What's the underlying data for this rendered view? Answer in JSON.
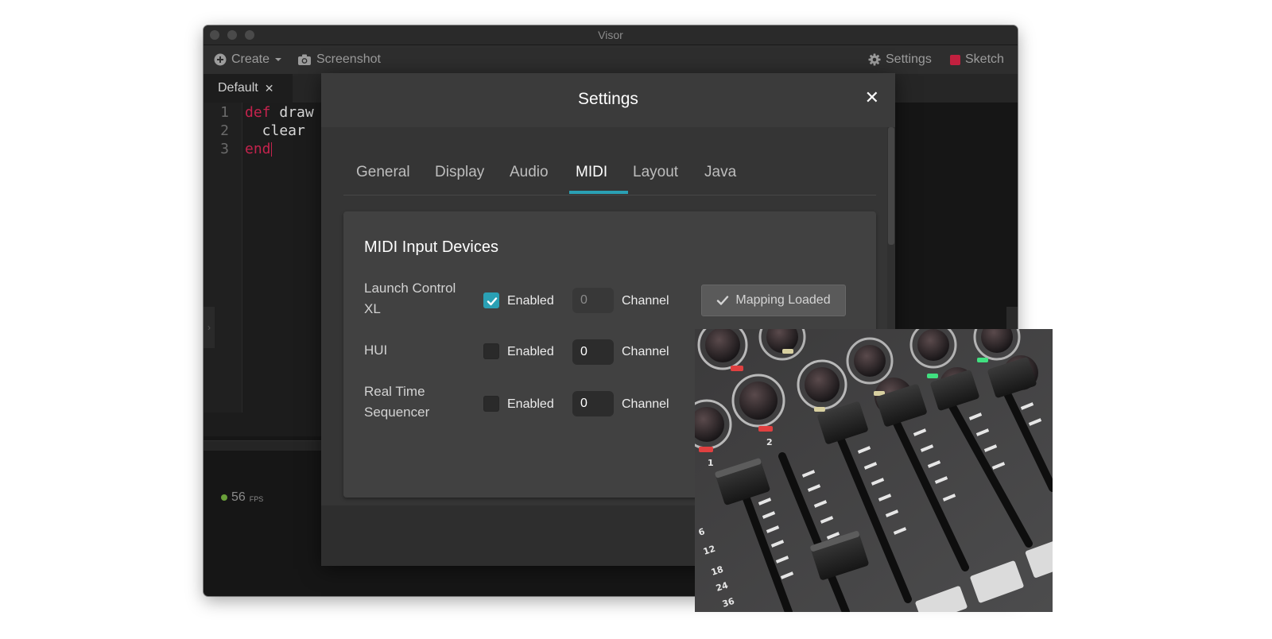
{
  "window": {
    "title": "Visor"
  },
  "toolbar": {
    "create_label": "Create",
    "screenshot_label": "Screenshot",
    "settings_label": "Settings",
    "sketch_label": "Sketch"
  },
  "editor": {
    "tab_label": "Default",
    "tab_close": "✕",
    "lines": [
      {
        "number": "1",
        "keyword": "def",
        "rest": " draw"
      },
      {
        "number": "2",
        "keyword": "",
        "rest": "  clear"
      },
      {
        "number": "3",
        "keyword": "end",
        "rest": ""
      }
    ],
    "fps_value": "56",
    "fps_unit": "FPS"
  },
  "settings": {
    "title": "Settings",
    "close": "✕",
    "tabs": [
      "General",
      "Display",
      "Audio",
      "MIDI",
      "Layout",
      "Java"
    ],
    "active_tab": "MIDI",
    "section_title": "MIDI Input Devices",
    "devices": [
      {
        "name": "Launch Control XL",
        "enabled": true,
        "enabled_label": "Enabled",
        "channel": "0",
        "channel_label": "Channel",
        "mapping_label": "Mapping Loaded"
      },
      {
        "name": "HUI",
        "enabled": false,
        "enabled_label": "Enabled",
        "channel": "0",
        "channel_label": "Channel"
      },
      {
        "name": "Real Time Sequencer",
        "enabled": false,
        "enabled_label": "Enabled",
        "channel": "0",
        "channel_label": "Channel"
      }
    ]
  },
  "photo": {
    "channel_numbers": [
      "1",
      "2"
    ],
    "fader_scale": [
      "6",
      "12",
      "18",
      "24",
      "36"
    ]
  },
  "colors": {
    "accent": "#2aa0b4",
    "keyword": "#c4234d",
    "sketch_icon": "#c2203f",
    "fps_dot": "#6aa03a"
  }
}
